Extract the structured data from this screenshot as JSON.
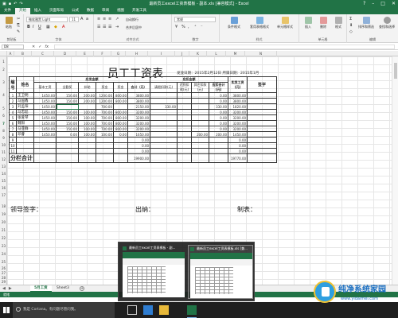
{
  "window": {
    "title": "最新员工excel工资表模板 - 副本.xls [兼容模式] - Excel"
  },
  "ribbon": {
    "tabs": [
      "文件",
      "开始",
      "插入",
      "页面布局",
      "公式",
      "数据",
      "审阅",
      "视图",
      "开发工具"
    ],
    "active_tab": "开始",
    "font_name": "微软雅黑 Light",
    "font_size": "11",
    "wrap_label": "自动换行",
    "merge_label": "合并后居中",
    "number_format": "常规",
    "groups": [
      "剪贴板",
      "字体",
      "对齐方式",
      "数字",
      "样式",
      "单元格",
      "编辑"
    ],
    "buttons": {
      "paste": "粘贴",
      "conditional": "条件格式",
      "table_format": "套用表格格式",
      "cell_style": "单元格样式",
      "insert": "插入",
      "delete": "删除",
      "format": "格式",
      "sort": "排序和筛选",
      "find": "查找和选择"
    }
  },
  "formula_bar": {
    "name_box": "D8",
    "fx": "fx"
  },
  "columns": [
    "A",
    "B",
    "C",
    "D",
    "E",
    "F",
    "G",
    "H",
    "I",
    "J",
    "K",
    "L",
    "M",
    "N"
  ],
  "rows": [
    "1",
    "2",
    "3",
    "4",
    "5",
    "6",
    "7",
    "8",
    "9",
    "10",
    "11",
    "12",
    "13",
    "14",
    "15",
    "16",
    "17",
    "18",
    "19",
    "20",
    "21",
    "22",
    "23",
    "24",
    "25",
    "26",
    "27",
    "28",
    "29"
  ],
  "document": {
    "title": "员工工资表",
    "issue_line": "发放日期：2015年2月12日 所属日期：2015年1月",
    "headers": {
      "no": "编号",
      "name": "姓名",
      "payable": "应发金额",
      "deduct": "应扣金额",
      "actual": "实发工资(元)",
      "sign": "签字",
      "sub_payable": [
        "基本工资",
        "全勤奖",
        "补助",
        "奖金",
        "奖金",
        "合计（元）"
      ],
      "sub_deduct": [
        "请假扣款(元)",
        "迟到扣款(元)",
        "其它扣款(元)",
        "应扣合计(元)"
      ]
    },
    "employees": [
      {
        "no": "1",
        "name": "王卫明",
        "base": "1450.00",
        "attend": "150.00",
        "sub": "200.00",
        "bonus1": "1200.00",
        "bonus2": "800.00",
        "total": "3800.00",
        "leave": "",
        "late": "",
        "other": "",
        "ded_total": "0.00",
        "actual": "3800.00"
      },
      {
        "no": "2",
        "name": "马国鑫",
        "base": "1450.00",
        "attend": "150.00",
        "sub": "200.00",
        "bonus1": "1200.00",
        "bonus2": "800.00",
        "total": "3800.00",
        "leave": "",
        "late": "",
        "other": "",
        "ded_total": "0.00",
        "actual": "3800.00"
      },
      {
        "no": "3",
        "name": "刘孟阳",
        "base": "1450.00",
        "attend": "",
        "sub": "",
        "bonus1": "700.00",
        "bonus2": "",
        "total": "2150.00",
        "leave": "330.00",
        "late": "",
        "other": "",
        "ded_total": "330.00",
        "actual": "1820.00"
      },
      {
        "no": "4",
        "name": "马忠彪",
        "base": "1450.00",
        "attend": "150.00",
        "sub": "100.00",
        "bonus1": "700.00",
        "bonus2": "800.00",
        "total": "3200.00",
        "leave": "",
        "late": "",
        "other": "",
        "ded_total": "0.00",
        "actual": "3200.00"
      },
      {
        "no": "5",
        "name": "张爱琴",
        "base": "1450.00",
        "attend": "150.00",
        "sub": "100.00",
        "bonus1": "700.00",
        "bonus2": "800.00",
        "total": "3200.00",
        "leave": "",
        "late": "",
        "other": "",
        "ded_total": "0.00",
        "actual": "3200.00"
      },
      {
        "no": "6",
        "name": "魏阳",
        "base": "1450.00",
        "attend": "150.00",
        "sub": "100.00",
        "bonus1": "700.00",
        "bonus2": "800.00",
        "total": "3200.00",
        "leave": "",
        "late": "",
        "other": "",
        "ded_total": "0.00",
        "actual": "3200.00"
      },
      {
        "no": "7",
        "name": "马亚群",
        "base": "1450.00",
        "attend": "150.00",
        "sub": "100.00",
        "bonus1": "700.00",
        "bonus2": "800.00",
        "total": "3200.00",
        "leave": "",
        "late": "",
        "other": "",
        "ded_total": "0.00",
        "actual": "3200.00"
      },
      {
        "no": "8",
        "name": "邓睿",
        "base": "1450.00",
        "attend": "0.00",
        "sub": "100.00",
        "bonus1": "100.00",
        "bonus2": "0.00",
        "total": "1650.00",
        "leave": "",
        "late": "",
        "other": "200.00",
        "ded_total": "200.00",
        "actual": "1450.00"
      },
      {
        "no": "9",
        "name": "",
        "base": "",
        "attend": "",
        "sub": "",
        "bonus1": "",
        "bonus2": "",
        "total": "0.00",
        "leave": "",
        "late": "",
        "other": "",
        "ded_total": "",
        "actual": "0.00"
      },
      {
        "no": "10",
        "name": "",
        "base": "",
        "attend": "",
        "sub": "",
        "bonus1": "",
        "bonus2": "",
        "total": "0.00",
        "leave": "",
        "late": "",
        "other": "",
        "ded_total": "",
        "actual": "0.00"
      },
      {
        "no": "11",
        "name": "",
        "base": "",
        "attend": "",
        "sub": "",
        "bonus1": "",
        "bonus2": "",
        "total": "0.00",
        "leave": "",
        "late": "",
        "other": "",
        "ded_total": "",
        "actual": "0.00"
      }
    ],
    "subtotal_label": "分栏合计",
    "subtotal_total": "19900.00",
    "subtotal_actual": "19770.00",
    "footer": {
      "leader": "领导签字：",
      "cashier": "出纳：",
      "maker": "制表："
    }
  },
  "sheet_tabs": [
    "5月工资",
    "Sheet3"
  ],
  "active_sheet": "5月工资",
  "status_text": "就绪",
  "taskbar": {
    "cortana_text": "我是 Cortana。有问题尽管问我。",
    "thumbnails": [
      {
        "title": "最新员工excel工资表模板 - 副..."
      },
      {
        "title": "最新员工excel工资表模板.xls [兼..."
      }
    ]
  },
  "watermark": {
    "name": "纯净系统家园",
    "url": "www.yidaimei.com"
  },
  "colors": {
    "excel_green": "#217346",
    "taskbar": "#1f1f1f",
    "watermark_blue": "#1a6fc2"
  }
}
